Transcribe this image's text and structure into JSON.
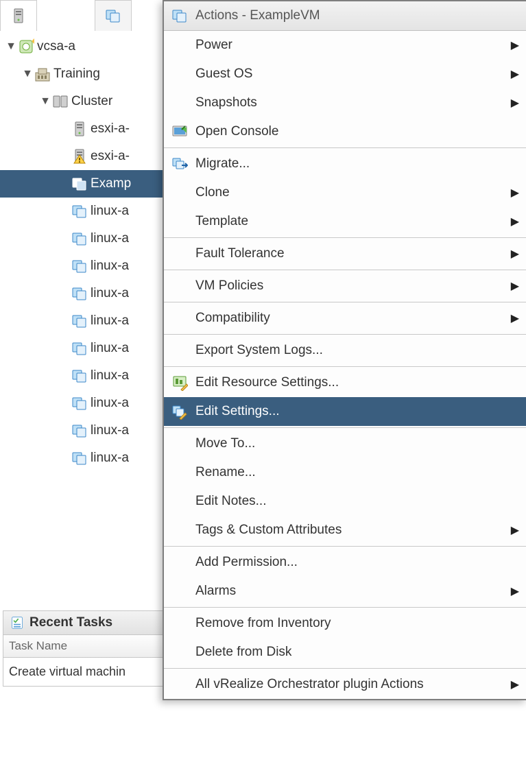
{
  "tabs": {
    "active_icon": "host",
    "inactive_icon": "vm"
  },
  "tree": {
    "root": {
      "label": "vcsa-a"
    },
    "datacenter": {
      "label": "Training"
    },
    "cluster": {
      "label": "Cluster"
    },
    "hosts": [
      {
        "label": "esxi-a-",
        "warn": false
      },
      {
        "label": "esxi-a-",
        "warn": true
      }
    ],
    "vms": [
      {
        "label": "Examp",
        "selected": true
      },
      {
        "label": "linux-a"
      },
      {
        "label": "linux-a"
      },
      {
        "label": "linux-a"
      },
      {
        "label": "linux-a"
      },
      {
        "label": "linux-a"
      },
      {
        "label": "linux-a"
      },
      {
        "label": "linux-a"
      },
      {
        "label": "linux-a"
      },
      {
        "label": "linux-a"
      },
      {
        "label": "linux-a"
      }
    ]
  },
  "recent": {
    "title": "Recent Tasks",
    "col1": "Task Name",
    "rows": [
      "Create virtual machin"
    ]
  },
  "menu": {
    "title": "Actions - ExampleVM",
    "groups": [
      [
        {
          "label": "Power",
          "submenu": true
        },
        {
          "label": "Guest OS",
          "submenu": true
        },
        {
          "label": "Snapshots",
          "submenu": true
        },
        {
          "label": "Open Console",
          "icon": "console"
        }
      ],
      [
        {
          "label": "Migrate...",
          "icon": "migrate"
        },
        {
          "label": "Clone",
          "submenu": true
        },
        {
          "label": "Template",
          "submenu": true
        }
      ],
      [
        {
          "label": "Fault Tolerance",
          "submenu": true
        }
      ],
      [
        {
          "label": "VM Policies",
          "submenu": true
        }
      ],
      [
        {
          "label": "Compatibility",
          "submenu": true
        }
      ],
      [
        {
          "label": "Export System Logs..."
        }
      ],
      [
        {
          "label": "Edit Resource Settings...",
          "icon": "edit-resource"
        },
        {
          "label": "Edit Settings...",
          "icon": "edit-settings",
          "selected": true
        }
      ],
      [
        {
          "label": "Move To..."
        },
        {
          "label": "Rename..."
        },
        {
          "label": "Edit Notes..."
        },
        {
          "label": "Tags & Custom Attributes",
          "submenu": true
        }
      ],
      [
        {
          "label": "Add Permission..."
        },
        {
          "label": "Alarms",
          "submenu": true
        }
      ],
      [
        {
          "label": "Remove from Inventory"
        },
        {
          "label": "Delete from Disk"
        }
      ],
      [
        {
          "label": "All vRealize Orchestrator plugin Actions",
          "submenu": true
        }
      ]
    ]
  }
}
